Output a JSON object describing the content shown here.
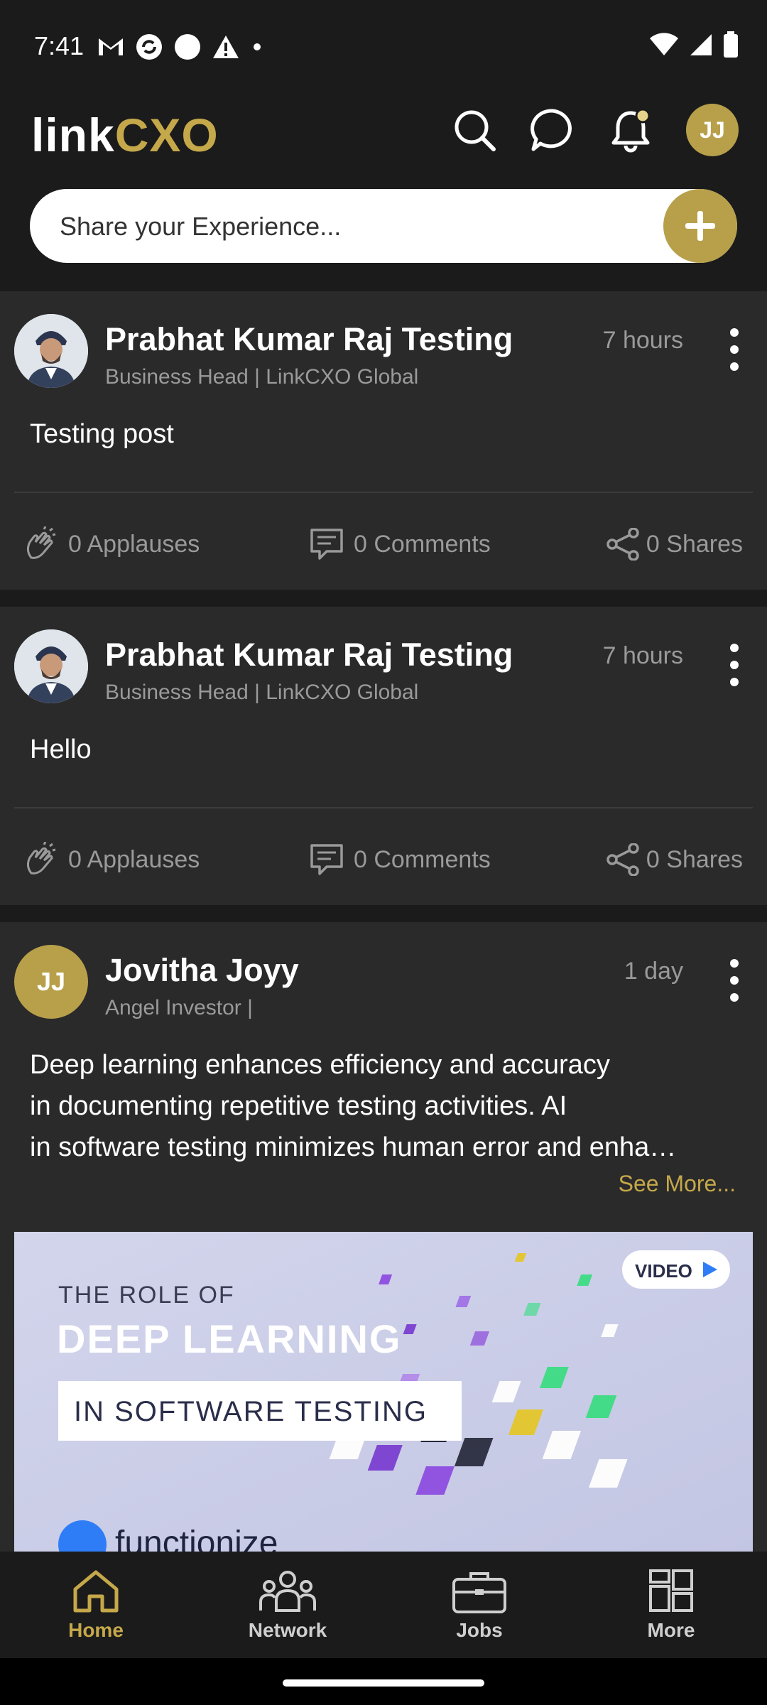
{
  "status_bar": {
    "time": "7:41"
  },
  "header": {
    "logo_part1": "link",
    "logo_part2": "CXO",
    "avatar_initials": "JJ",
    "share_placeholder": "Share your Experience..."
  },
  "posts": [
    {
      "author": "Prabhat Kumar Raj Testing",
      "subtitle": "Business Head | LinkCXO Global",
      "time": "7 hours",
      "body": "Testing post",
      "applauses": "0 Applauses",
      "comments": "0 Comments",
      "shares": "0 Shares"
    },
    {
      "author": "Prabhat Kumar Raj Testing",
      "subtitle": "Business Head | LinkCXO Global",
      "time": "7 hours",
      "body": "Hello",
      "applauses": "0 Applauses",
      "comments": "0 Comments",
      "shares": "0 Shares"
    },
    {
      "author": "Jovitha Joyy",
      "avatar_initials": "JJ",
      "subtitle": "Angel Investor |",
      "time": "1 day",
      "body_line1": "Deep learning enhances efficiency and accuracy",
      "body_line2": "in documenting repetitive testing activities. AI",
      "body_line3": "in software testing minimizes human error and enha…",
      "see_more": "See More...",
      "media": {
        "badge": "VIDEO",
        "line1": "THE ROLE OF",
        "line2": "DEEP LEARNING",
        "line3": "IN SOFTWARE TESTING",
        "brand": "functionize"
      }
    }
  ],
  "bottom_nav": [
    {
      "label": "Home",
      "icon": "home-icon",
      "active": true
    },
    {
      "label": "Network",
      "icon": "network-icon",
      "active": false
    },
    {
      "label": "Jobs",
      "icon": "briefcase-icon",
      "active": false
    },
    {
      "label": "More",
      "icon": "grid-icon",
      "active": false
    }
  ],
  "colors": {
    "accent": "#c5a84a",
    "background": "#1b1b1b",
    "card": "#2a2a2a"
  }
}
